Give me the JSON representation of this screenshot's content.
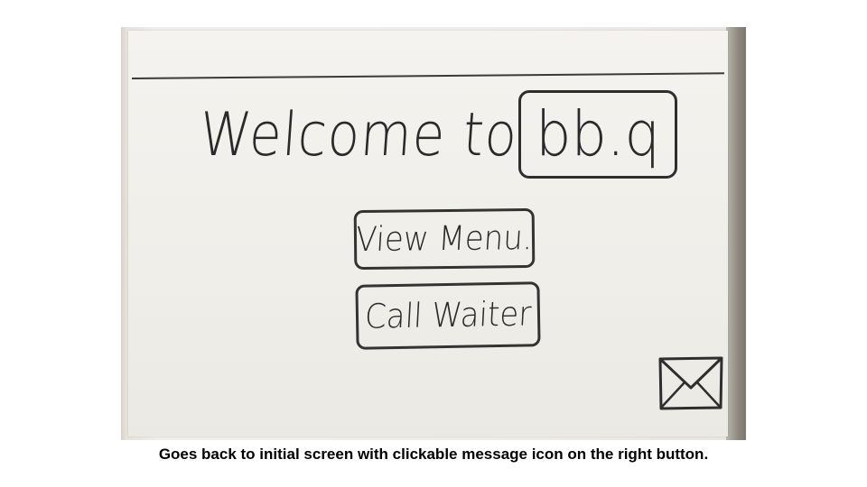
{
  "prototype": {
    "heading": "Welcome to",
    "logo": "bb.q",
    "buttons": {
      "view_menu": "View Menu.",
      "call_waiter": "Call Waiter"
    },
    "message_icon": "envelope-icon"
  },
  "caption": "Goes back to initial screen with clickable message icon on the right button.",
  "colors": {
    "ink": "#2a2a2a",
    "paper": "#f2f1ec",
    "caption": "#000000"
  }
}
